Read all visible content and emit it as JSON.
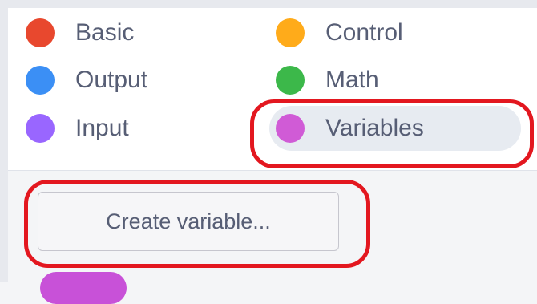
{
  "categories": {
    "items": [
      {
        "label": "Basic",
        "color": "#e8482e"
      },
      {
        "label": "Control",
        "color": "#ffab1a"
      },
      {
        "label": "Output",
        "color": "#3b8ff5"
      },
      {
        "label": "Math",
        "color": "#3cb84a"
      },
      {
        "label": "Input",
        "color": "#9966ff"
      },
      {
        "label": "Variables",
        "color": "#d05bd6"
      }
    ],
    "selected": "Variables"
  },
  "flyout": {
    "create_variable_label": "Create variable...",
    "block_color": "#c851d8"
  },
  "highlight_color": "#e3171f"
}
